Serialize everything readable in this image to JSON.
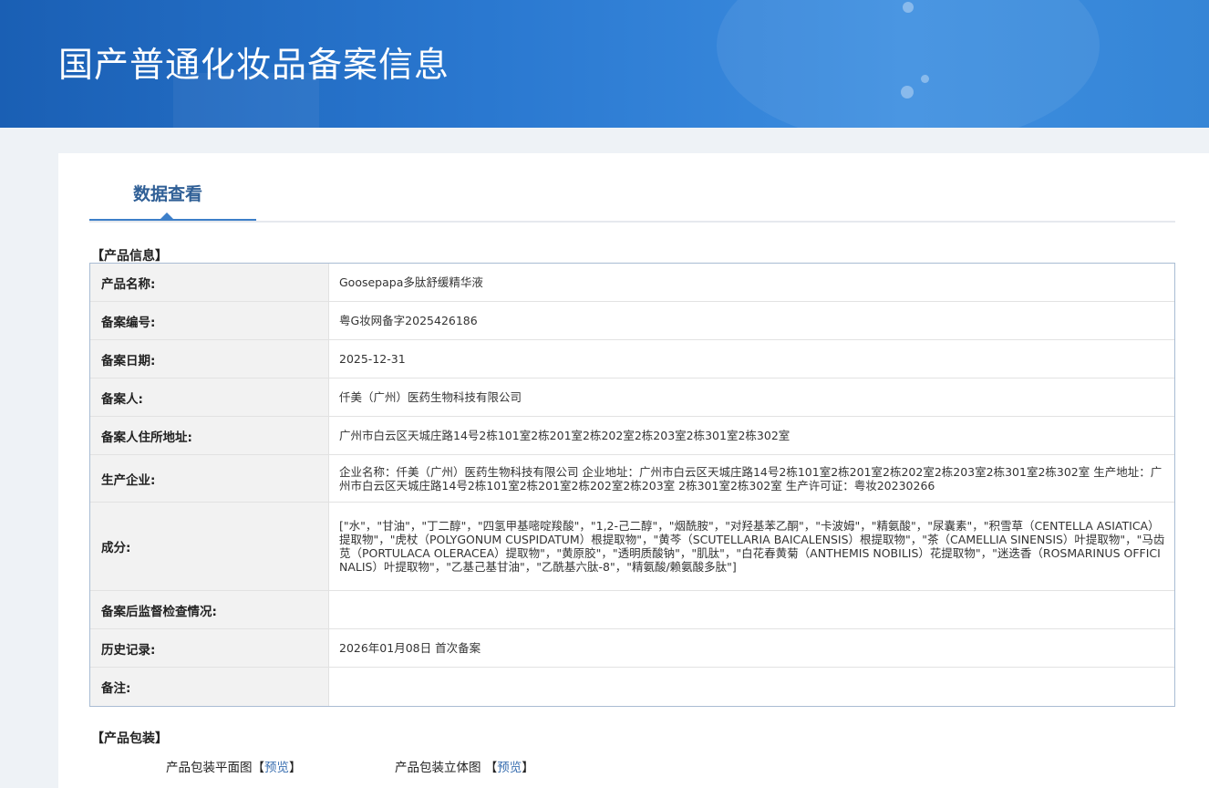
{
  "banner": {
    "title": "国产普通化妆品备案信息"
  },
  "tabs": [
    {
      "label": "数据查看",
      "active": true
    }
  ],
  "sections": {
    "product_info_title": "【产品信息】",
    "packaging_title": "【产品包装】"
  },
  "info_rows": [
    {
      "label": "产品名称:",
      "value": "Goosepapa多肽舒缓精华液"
    },
    {
      "label": "备案编号:",
      "value": "粤G妆网备字2025426186"
    },
    {
      "label": "备案日期:",
      "value": "2025-12-31"
    },
    {
      "label": "备案人:",
      "value": "仟美（广州）医药生物科技有限公司"
    },
    {
      "label": "备案人住所地址:",
      "value": "广州市白云区天城庄路14号2栋101室2栋201室2栋202室2栋203室2栋301室2栋302室"
    },
    {
      "label": "生产企业:",
      "value": "企业名称：仟美（广州）医药生物科技有限公司 企业地址：广州市白云区天城庄路14号2栋101室2栋201室2栋202室2栋203室2栋301室2栋302室 生产地址：广州市白云区天城庄路14号2栋101室2栋201室2栋202室2栋203室 2栋301室2栋302室 生产许可证：粤妆20230266"
    },
    {
      "label": "成分:",
      "value": "[\"水\"，\"甘油\"，\"丁二醇\"，\"四氢甲基嘧啶羧酸\"，\"1,2-己二醇\"，\"烟酰胺\"，\"对羟基苯乙酮\"，\"卡波姆\"，\"精氨酸\"，\"尿囊素\"，\"积雪草（CENTELLA ASIATICA）提取物\"，\"虎杖（POLYGONUM CUSPIDATUM）根提取物\"，\"黄芩（SCUTELLARIA BAICALENSIS）根提取物\"，\"茶（CAMELLIA SINENSIS）叶提取物\"，\"马齿苋（PORTULACA OLERACEA）提取物\"，\"黄原胶\"，\"透明质酸钠\"，\"肌肽\"，\"白花春黄菊（ANTHEMIS NOBILIS）花提取物\"，\"迷迭香（ROSMARINUS OFFICINALIS）叶提取物\"，\"乙基己基甘油\"，\"乙酰基六肽-8\"，\"精氨酸/赖氨酸多肽\"]"
    },
    {
      "label": "备案后监督检查情况:",
      "value": ""
    },
    {
      "label": "历史记录:",
      "value": "2026年01月08日 首次备案"
    },
    {
      "label": "备注:",
      "value": ""
    }
  ],
  "packaging": {
    "flat_label": "产品包装平面图",
    "flat_open": "【",
    "flat_link": "预览",
    "flat_close": "】",
    "three_d_label": "产品包装立体图",
    "three_d_open": "【",
    "three_d_link": "预览",
    "three_d_close": "】"
  }
}
